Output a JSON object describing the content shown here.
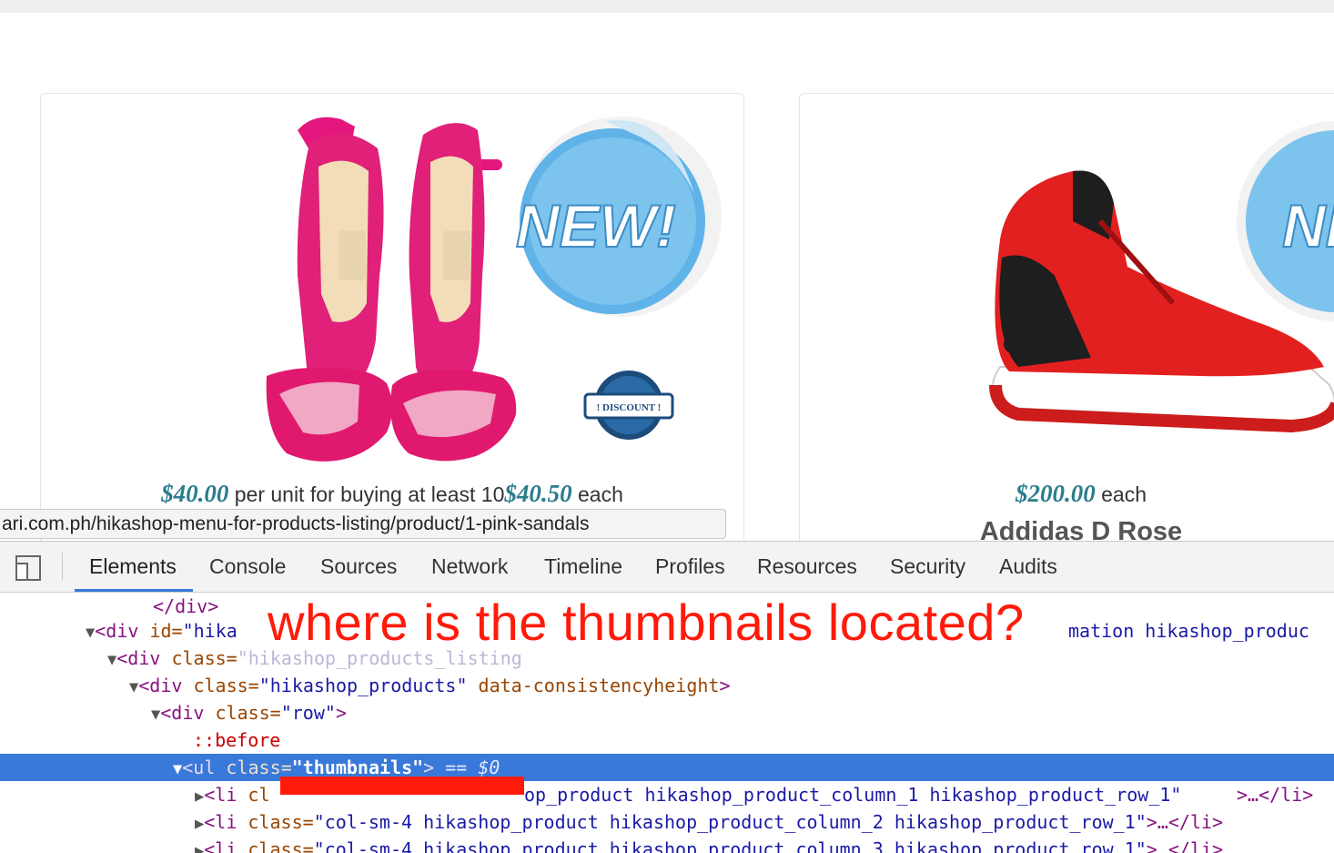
{
  "page": {
    "products": [
      {
        "price1": "$40.00",
        "price1_suffix": " per unit for buying at least 10",
        "price2": "$40.50",
        "price2_suffix": " each",
        "badge_new": "NEW!",
        "badge_discount": "! DISCOUNT !"
      },
      {
        "price1": "$200.00",
        "price1_suffix": " each",
        "name": "Addidas D Rose",
        "badge_new": "NE"
      }
    ],
    "status_url": "ari.com.ph/hikashop-menu-for-products-listing/product/1-pink-sandals"
  },
  "devtools": {
    "tabs": [
      "Elements",
      "Console",
      "Sources",
      "Network",
      "Timeline",
      "Profiles",
      "Resources",
      "Security",
      "Audits"
    ],
    "active_tab": "Elements",
    "code": {
      "l0": "</div>",
      "l1_tag": "<div",
      "l1_attr": " id=",
      "l1_val": "\"hika",
      "l1_tail": "mation hikashop_produc",
      "l2_tag": "<div",
      "l2_attr": " class=",
      "l2_val": "\"hikashop_products_listing",
      "l3_tag": "<div",
      "l3_attr": " class=",
      "l3_val": "\"hikashop_products\"",
      "l3_attr2": " data-consistencyheight",
      "l3_close": ">",
      "l4_tag": "<div",
      "l4_attr": " class=",
      "l4_val": "\"row\"",
      "l4_close": ">",
      "l5": "::before",
      "l6_tag": "<ul",
      "l6_attr": " class=",
      "l6_val": "\"thumbnails\"",
      "l6_close": ">",
      "l6_eq": " == $0",
      "l7_tag": "<li",
      "l7_attr": " cl",
      "l7_val": "op_product hikashop_product_column_1 hikashop_product_row_1\"",
      "l7_close": ">…</li>",
      "l8_tag": "<li",
      "l8_attr": " class=",
      "l8_val": "\"col-sm-4 hikashop_product hikashop_product_column_2 hikashop_product_row_1\"",
      "l8_close": ">…</li>",
      "l9_tag": "<li",
      "l9_attr": " class=",
      "l9_val": "\"col-sm-4 hikashop_product hikashop_product_column_3 hikashop_product_row_1\"",
      "l9_close": ">…</li>"
    }
  },
  "annotation": {
    "question": "where is the thumbnails located?"
  },
  "colors": {
    "accent": "#3879d9",
    "annotation": "#ff1a0a",
    "price": "#2a7d8c"
  }
}
